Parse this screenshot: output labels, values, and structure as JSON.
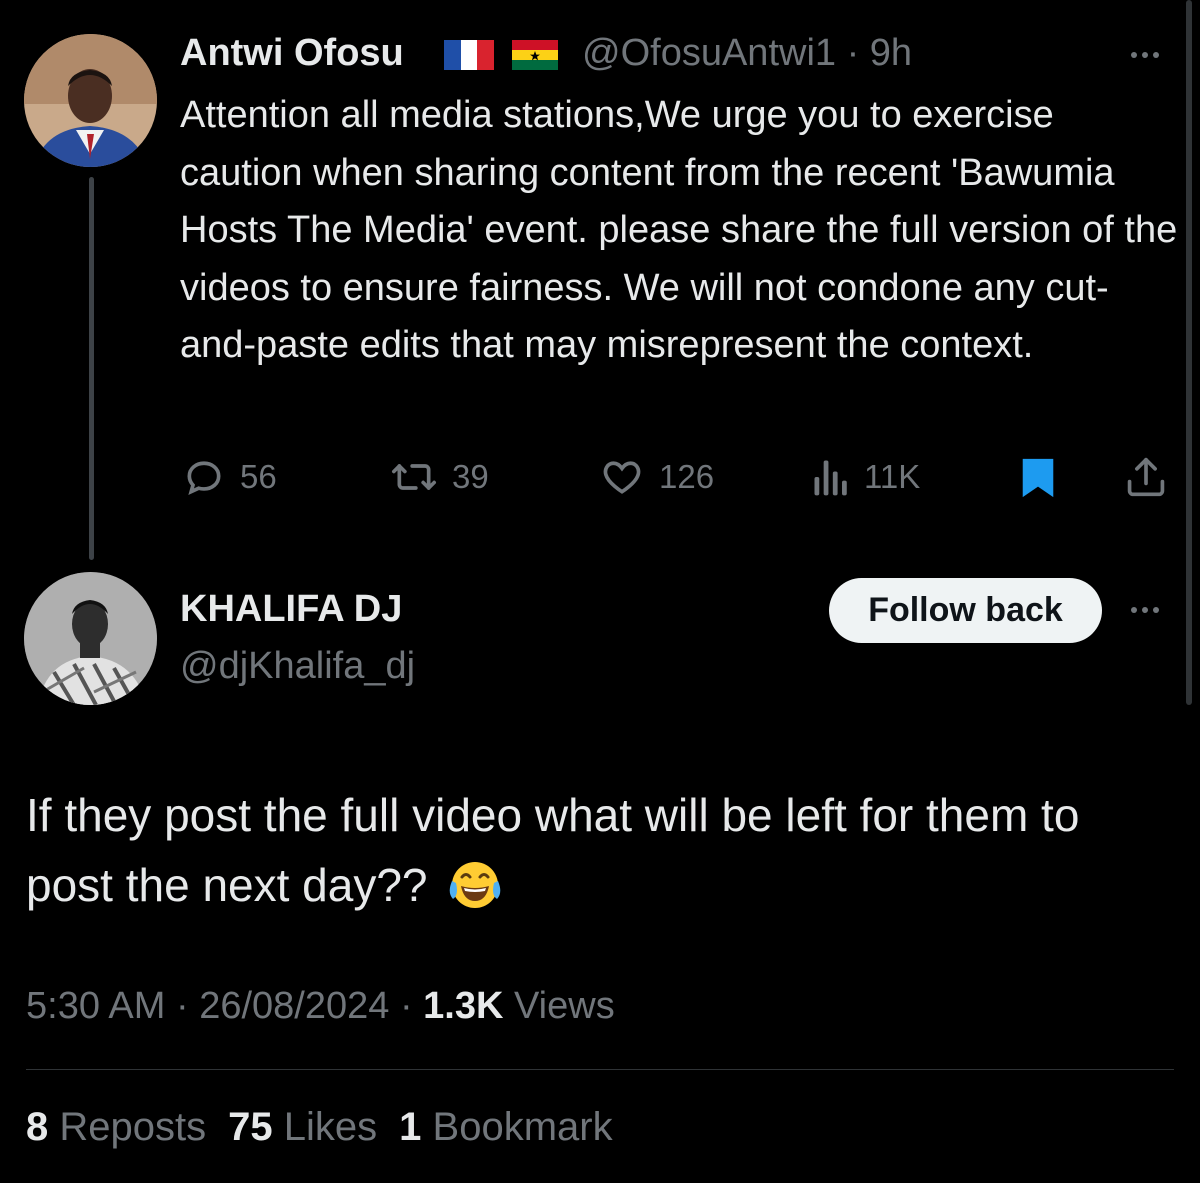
{
  "parent_tweet": {
    "author_name": "Antwi Ofosu",
    "flags": [
      "france-flag",
      "ghana-flag"
    ],
    "handle": "@OfosuAntwi1",
    "separator": "·",
    "time": "9h",
    "text": "Attention all media stations,We urge you to exercise caution when sharing content from the recent 'Bawumia Hosts The Media' event. please share the full version of the videos to ensure fairness. We will not condone any cut-and-paste edits that may misrepresent the context.",
    "actions": {
      "replies": "56",
      "reposts": "39",
      "likes": "126",
      "views": "11K"
    },
    "icons": [
      "reply-icon",
      "repost-icon",
      "like-icon",
      "views-icon",
      "bookmark-icon",
      "share-icon"
    ],
    "bookmark_color": "#1d9bf0"
  },
  "reply_tweet": {
    "author_name": "KHALIFA DJ",
    "handle": "@djKhalifa_dj",
    "follow_label": "Follow back",
    "text": "If they post the full video what will be left for them to post the next day??",
    "emoji": "face-with-tears-of-joy",
    "meta": {
      "time": "5:30 AM",
      "date": "26/08/2024",
      "views_count": "1.3K",
      "views_label": "Views",
      "separator": "·"
    },
    "stats": {
      "reposts_count": "8",
      "reposts_label": "Reposts",
      "likes_count": "75",
      "likes_label": "Likes",
      "bookmarks_count": "1",
      "bookmarks_label": "Bookmark"
    }
  },
  "colors": {
    "background": "#000000",
    "primary_text": "#e7e9ea",
    "secondary_text": "#71767b",
    "accent": "#1d9bf0",
    "follow_button_bg": "#eff3f4"
  }
}
